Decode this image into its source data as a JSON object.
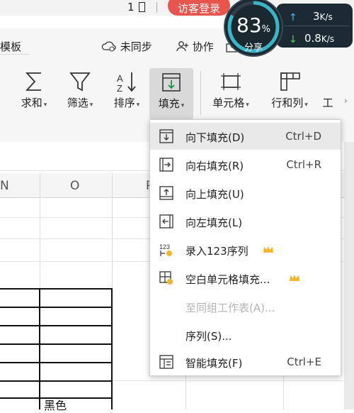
{
  "titlebar": {
    "page_indicator": "1",
    "login_label": "访客登录"
  },
  "toolbar": {
    "template_label": "模板",
    "sync_label": "未同步",
    "collab_label": "协作",
    "share_label": "分享"
  },
  "ribbon": {
    "buttons": [
      {
        "label": "求和",
        "icon": "sigma-icon"
      },
      {
        "label": "筛选",
        "icon": "filter-icon"
      },
      {
        "label": "排序",
        "icon": "sort-icon"
      },
      {
        "label": "填充",
        "icon": "fill-icon"
      },
      {
        "label": "单元格",
        "icon": "cell-icon"
      },
      {
        "label": "行和列",
        "icon": "rows-cols-icon"
      },
      {
        "label": "工",
        "icon": "worksheet-icon"
      }
    ]
  },
  "sheet": {
    "columns": [
      "N",
      "O",
      "P"
    ],
    "cell_text": "黑色"
  },
  "speed_widget": {
    "percent": "83",
    "percent_sign": "%",
    "up_value": "3",
    "up_unit": "K/s",
    "down_value": "0.8",
    "down_unit": "K/s",
    "accent": "#3bb4c8"
  },
  "fill_menu": {
    "items": [
      {
        "label": "向下填充(D)",
        "shortcut": "Ctrl+D",
        "icon": "fill-down-icon"
      },
      {
        "label": "向右填充(R)",
        "shortcut": "Ctrl+R",
        "icon": "fill-right-icon"
      },
      {
        "label": "向上填充(U)",
        "shortcut": "",
        "icon": "fill-up-icon"
      },
      {
        "label": "向左填充(L)",
        "shortcut": "",
        "icon": "fill-left-icon"
      },
      {
        "label": "录入123序列",
        "shortcut": "",
        "icon": "sequence-123-icon"
      },
      {
        "label": "空白单元格填充...",
        "shortcut": "",
        "icon": "blank-fill-icon"
      },
      {
        "label": "至同组工作表(A)...",
        "shortcut": "",
        "icon": ""
      },
      {
        "label": "序列(S)...",
        "shortcut": "",
        "icon": ""
      },
      {
        "label": "智能填充(F)",
        "shortcut": "Ctrl+E",
        "icon": "smart-fill-icon"
      }
    ]
  },
  "colors": {
    "login_bg": "#e8554d",
    "crown": "#f2b52c",
    "menu_hover": "#e9e9e9"
  }
}
